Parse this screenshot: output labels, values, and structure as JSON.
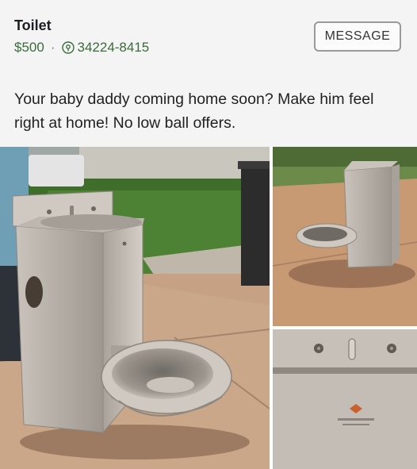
{
  "listing": {
    "title": "Toilet",
    "price": "$500",
    "separator": "·",
    "location_code": "34224-8415",
    "message_label": "MESSAGE",
    "description": "Your baby daddy coming home soon? Make him feel right at home! No low ball offers."
  },
  "icons": {
    "location": "location-pin-icon"
  },
  "colors": {
    "price_green": "#3a6b3a",
    "steel": "#b9b4ad"
  }
}
